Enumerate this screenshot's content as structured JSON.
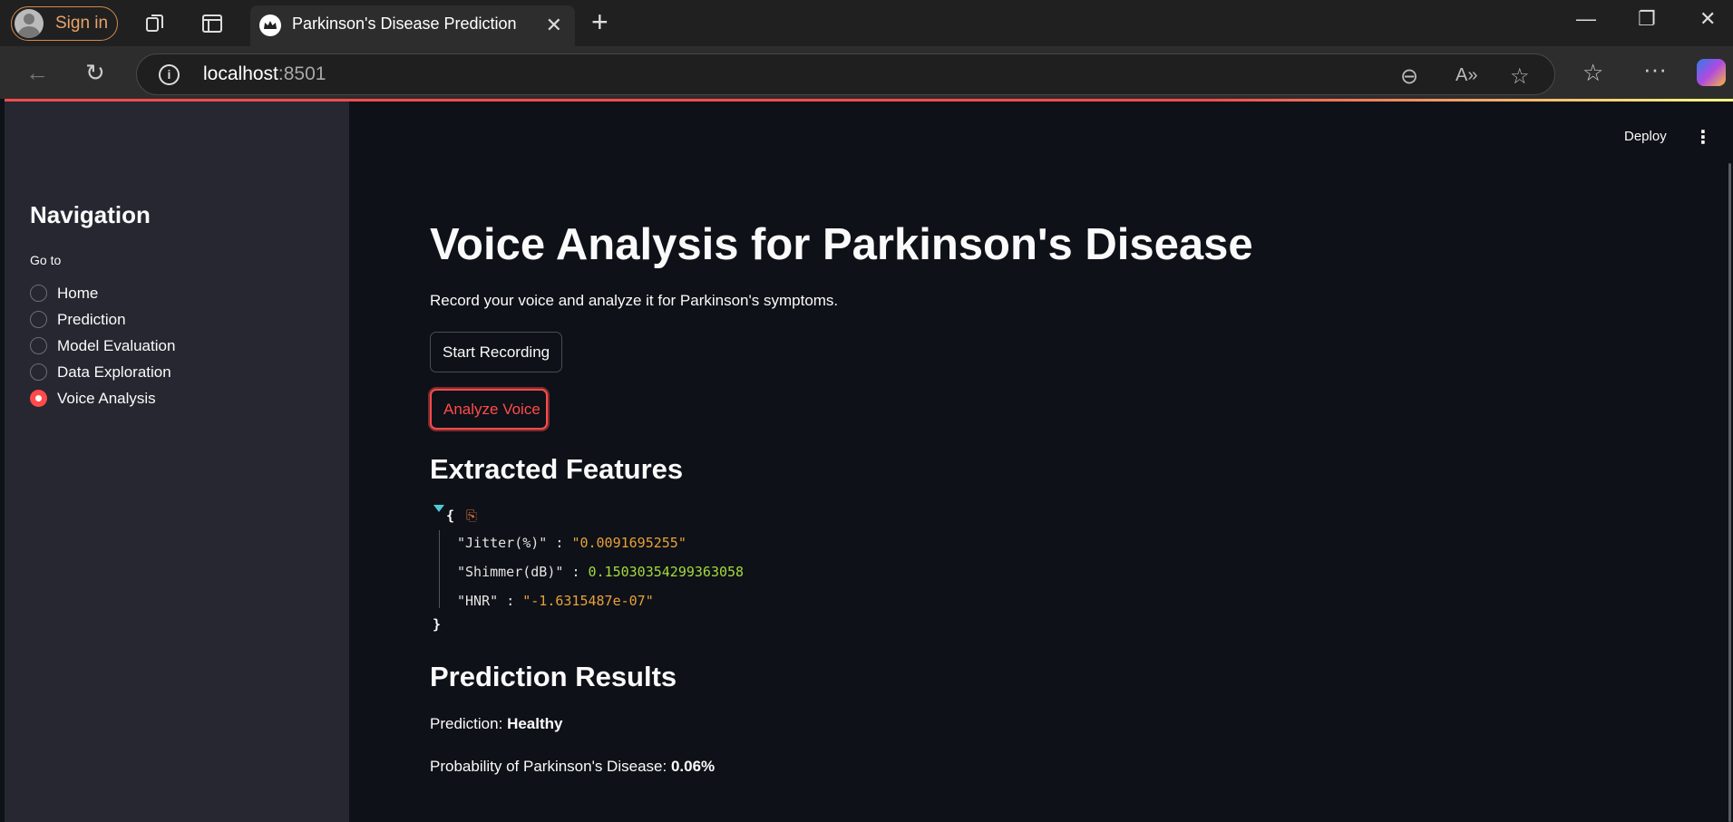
{
  "browser": {
    "signin_label": "Sign in",
    "tab_title": "Parkinson's Disease Prediction",
    "url_host": "localhost",
    "url_port": ":8501"
  },
  "toolbar": {
    "deploy_label": "Deploy"
  },
  "sidebar": {
    "title": "Navigation",
    "goto_label": "Go to",
    "items": [
      {
        "label": "Home",
        "selected": false
      },
      {
        "label": "Prediction",
        "selected": false
      },
      {
        "label": "Model Evaluation",
        "selected": false
      },
      {
        "label": "Data Exploration",
        "selected": false
      },
      {
        "label": "Voice Analysis",
        "selected": true
      }
    ]
  },
  "main": {
    "title": "Voice Analysis for Parkinson's Disease",
    "subtitle": "Record your voice and analyze it for Parkinson's symptoms.",
    "start_button": "Start Recording",
    "analyze_button": "Analyze Voice",
    "features_heading": "Extracted Features",
    "features": [
      {
        "key": "\"Jitter(%)\"",
        "value": "\"0.0091695255\"",
        "type": "str"
      },
      {
        "key": "\"Shimmer(dB)\"",
        "value": "0.15030354299363058",
        "type": "num"
      },
      {
        "key": "\"HNR\"",
        "value": "\"-1.6315487e-07\"",
        "type": "str"
      }
    ],
    "results_heading": "Prediction Results",
    "prediction_label": "Prediction:",
    "prediction_value": "Healthy",
    "probability_label": "Probability of Parkinson's Disease:",
    "probability_value": "0.06%"
  },
  "colors": {
    "accent": "#ff4b4b",
    "sidebar_bg": "#262730",
    "main_bg": "#0e1117"
  }
}
